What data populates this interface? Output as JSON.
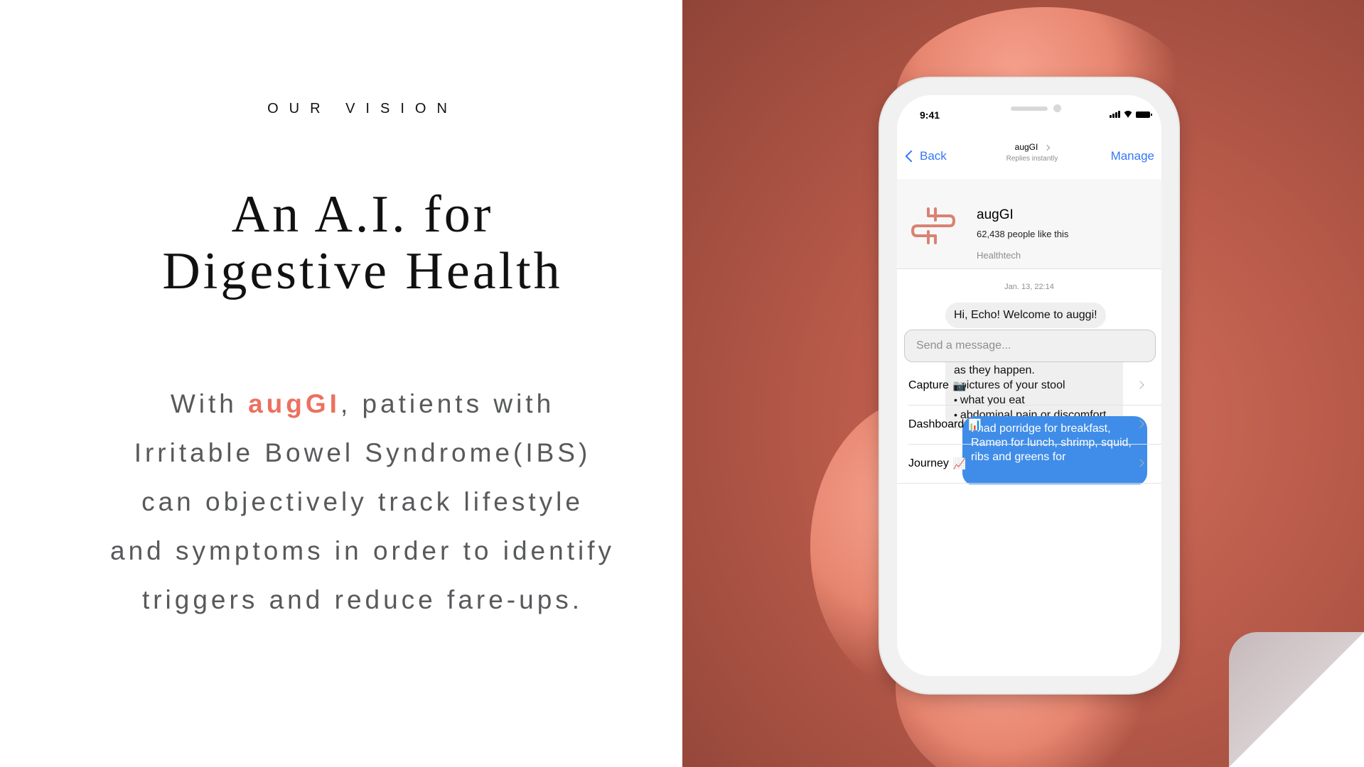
{
  "slide": {
    "eyebrow": "OUR VISION",
    "headline_line1": "An A.I. for",
    "headline_line2": "Digestive Health",
    "body_prefix": "With ",
    "brand": "augGI",
    "body_line1_suffix": ", patients with",
    "body_line2": "Irritable Bowel Syndrome(IBS)",
    "body_line3": "can objectively track lifestyle",
    "body_line4": "and symptoms in order to identify",
    "body_line5": "triggers and reduce fare-ups.",
    "brand_color": "#ec7160"
  },
  "phone": {
    "status": {
      "time": "9:41"
    },
    "nav": {
      "back_label": "Back",
      "title": "augGI",
      "subtitle": "Replies instantly",
      "manage_label": "Manage"
    },
    "profile": {
      "name": "augGI",
      "likes": "62,438 people like this",
      "category": "Healthtech",
      "logo_icon": "intestine-logo-icon"
    },
    "chat": {
      "date": "Jan. 13, 22:14",
      "bot_greeting": "Hi, Echo! Welcome to auggi!",
      "bot_request_intro": "Please let me know the following information as soon as they happen.",
      "bot_request_items": [
        "pictures of your stool",
        "what you eat",
        "abdominal pain or discomfort"
      ],
      "user_message": "I had porridge for breakfast, Ramen for lunch, shrimp, squid, ribs and greens for"
    },
    "composer": {
      "placeholder": "Send a message..."
    },
    "menu": [
      {
        "label": "Capture",
        "icon": "camera-icon",
        "glyph": "📷"
      },
      {
        "label": "Dashboard",
        "icon": "bar-chart-icon",
        "glyph": "📊"
      },
      {
        "label": "Journey",
        "icon": "line-chart-icon",
        "glyph": "📈"
      }
    ],
    "accent_color": "#3478f6",
    "user_bubble_color": "#3f8de8"
  }
}
